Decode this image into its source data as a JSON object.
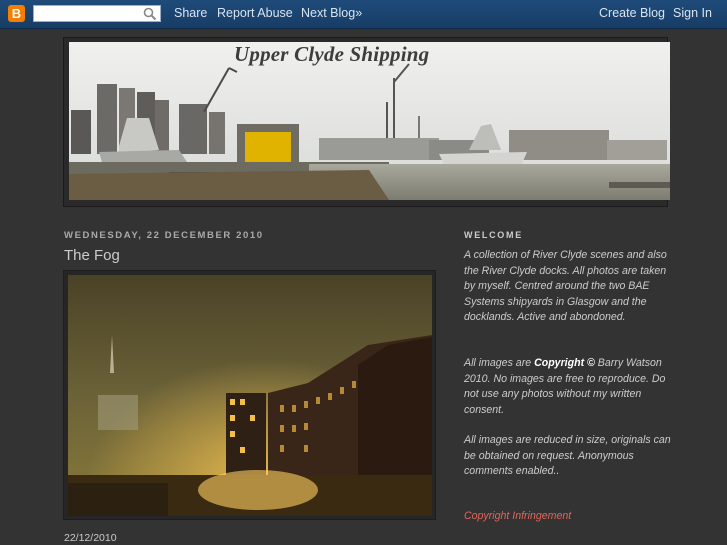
{
  "navbar": {
    "logo_letter": "B",
    "search_placeholder": "",
    "links": {
      "share": "Share",
      "report_abuse": "Report Abuse",
      "next_blog": "Next Blog»",
      "create_blog": "Create Blog",
      "sign_in": "Sign In"
    }
  },
  "header": {
    "title": "Upper Clyde Shipping"
  },
  "post": {
    "date_header": "WEDNESDAY, 22 DECEMBER 2010",
    "title": "The Fog",
    "footer_date": "22/12/2010"
  },
  "sidebar": {
    "heading": "WELCOME",
    "para1": "A collection of River Clyde scenes and also the River Clyde docks. All photos are taken by myself. Centred around the two BAE Systems shipyards in Glasgow and the docklands. Active and abondoned.",
    "para2_pre": "All images are ",
    "para2_bold": "Copyright ©",
    "para2_post": " Barry Watson 2010. No images are free to reproduce. Do not use any photos without my written consent.",
    "para3": "All images are reduced in size, originals can be obtained on request. Anonymous comments enabled..",
    "link": "Copyright Infringement"
  },
  "colors": {
    "background": "#333333",
    "navbar": "#1f4b7a",
    "text": "#cccccc",
    "link": "#e0665a"
  }
}
